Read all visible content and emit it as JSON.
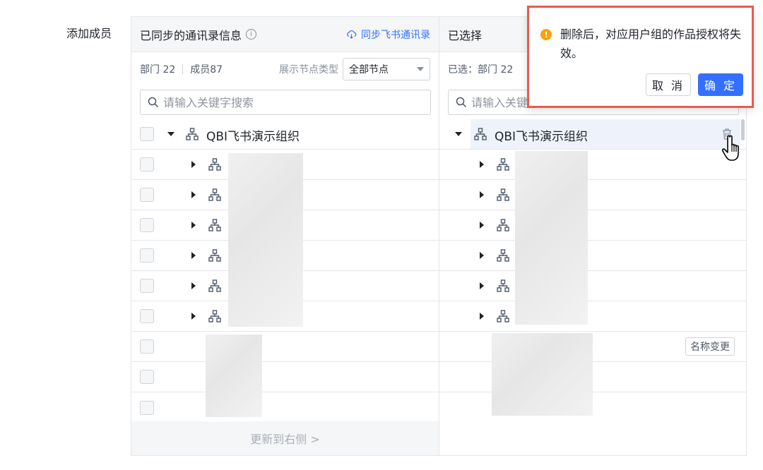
{
  "form": {
    "label": "添加成员"
  },
  "left_panel": {
    "title": "已同步的通讯录信息",
    "info_icon": "info-circle-icon",
    "sync_link": "同步飞书通讯录",
    "dept_count": "部门 22",
    "member_count": "成员87",
    "node_type_label": "展示节点类型",
    "node_type_value": "全部节点",
    "search_placeholder": "请输入关键字搜索",
    "root_label": "QBI飞书演示组织",
    "footer": "更新到右侧 >"
  },
  "right_panel": {
    "title": "已选择",
    "selected_label": "已选：部门 22",
    "search_placeholder": "请输入关键字搜索",
    "root_label": "QBI飞书演示组织",
    "rename_tag": "名称变更"
  },
  "popconfirm": {
    "message": "删除后，对应用户组的作品授权将失效。",
    "cancel": "取 消",
    "ok": "确 定"
  },
  "colors": {
    "accent": "#3370ff",
    "warning": "#ff9f0a",
    "highlight_border": "#ea5a4f"
  }
}
